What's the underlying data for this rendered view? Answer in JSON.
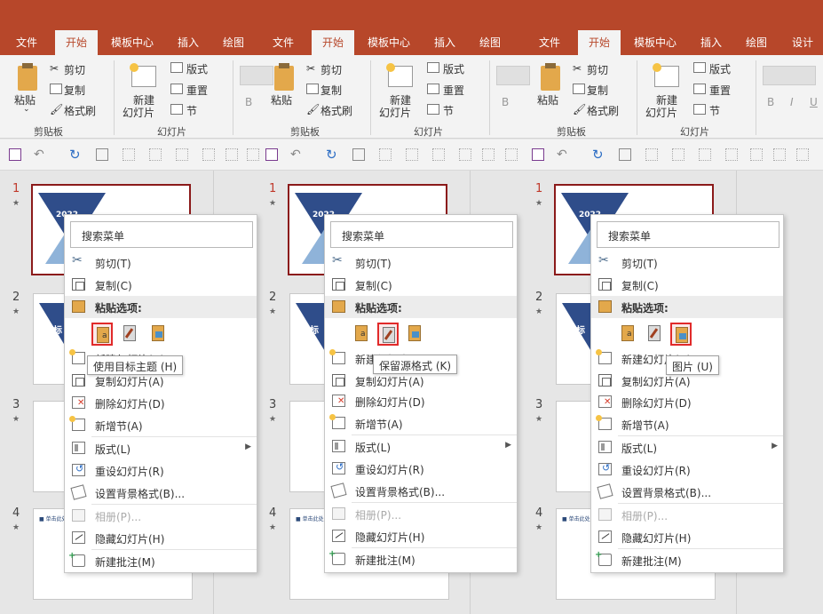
{
  "tabs": [
    "文件",
    "开始",
    "模板中心",
    "插入",
    "绘图"
  ],
  "extra_tab": "设计",
  "ribbon": {
    "paste": "粘贴",
    "cut": "剪切",
    "copy": "复制",
    "format_painter": "格式刷",
    "clipboard_group": "剪贴板",
    "new_slide_line1": "新建",
    "new_slide_line2": "幻灯片",
    "layout": "版式",
    "reset": "重置",
    "section": "节",
    "slides_group": "幻灯片",
    "bold": "B",
    "italic": "I",
    "underline": "U"
  },
  "slide_numbers": [
    "1",
    "2",
    "3",
    "4"
  ],
  "slide_text": {
    "year": "2022",
    "title_fragment": "目标",
    "doc_header": "■ 单击此处添加"
  },
  "menu": {
    "search": "搜索菜单",
    "cut": "剪切(T)",
    "copy": "复制(C)",
    "paste_options": "粘贴选项:",
    "new_slide": "新建幻灯片(N)",
    "duplicate_slide": "复制幻灯片(A)",
    "delete_slide": "删除幻灯片(D)",
    "add_section": "新增节(A)",
    "layout": "版式(L)",
    "reset_slide": "重设幻灯片(R)",
    "format_background": "设置背景格式(B)...",
    "photo_album": "相册(P)...",
    "hide_slide": "隐藏幻灯片(H)",
    "new_comment": "新建批注(M)"
  },
  "tooltips": [
    "使用目标主题 (H)",
    "保留源格式 (K)",
    "图片 (U)"
  ],
  "colors": {
    "accent": "#b7472a",
    "highlight": "#e12a2a",
    "selected_slide": "#8b1a1a"
  },
  "icons": [
    "cut-icon",
    "copy-icon",
    "paste-icon",
    "new-slide-icon",
    "delete-slide-icon",
    "layout-icon",
    "reset-icon",
    "background-icon",
    "album-icon",
    "hide-icon",
    "comment-icon"
  ]
}
